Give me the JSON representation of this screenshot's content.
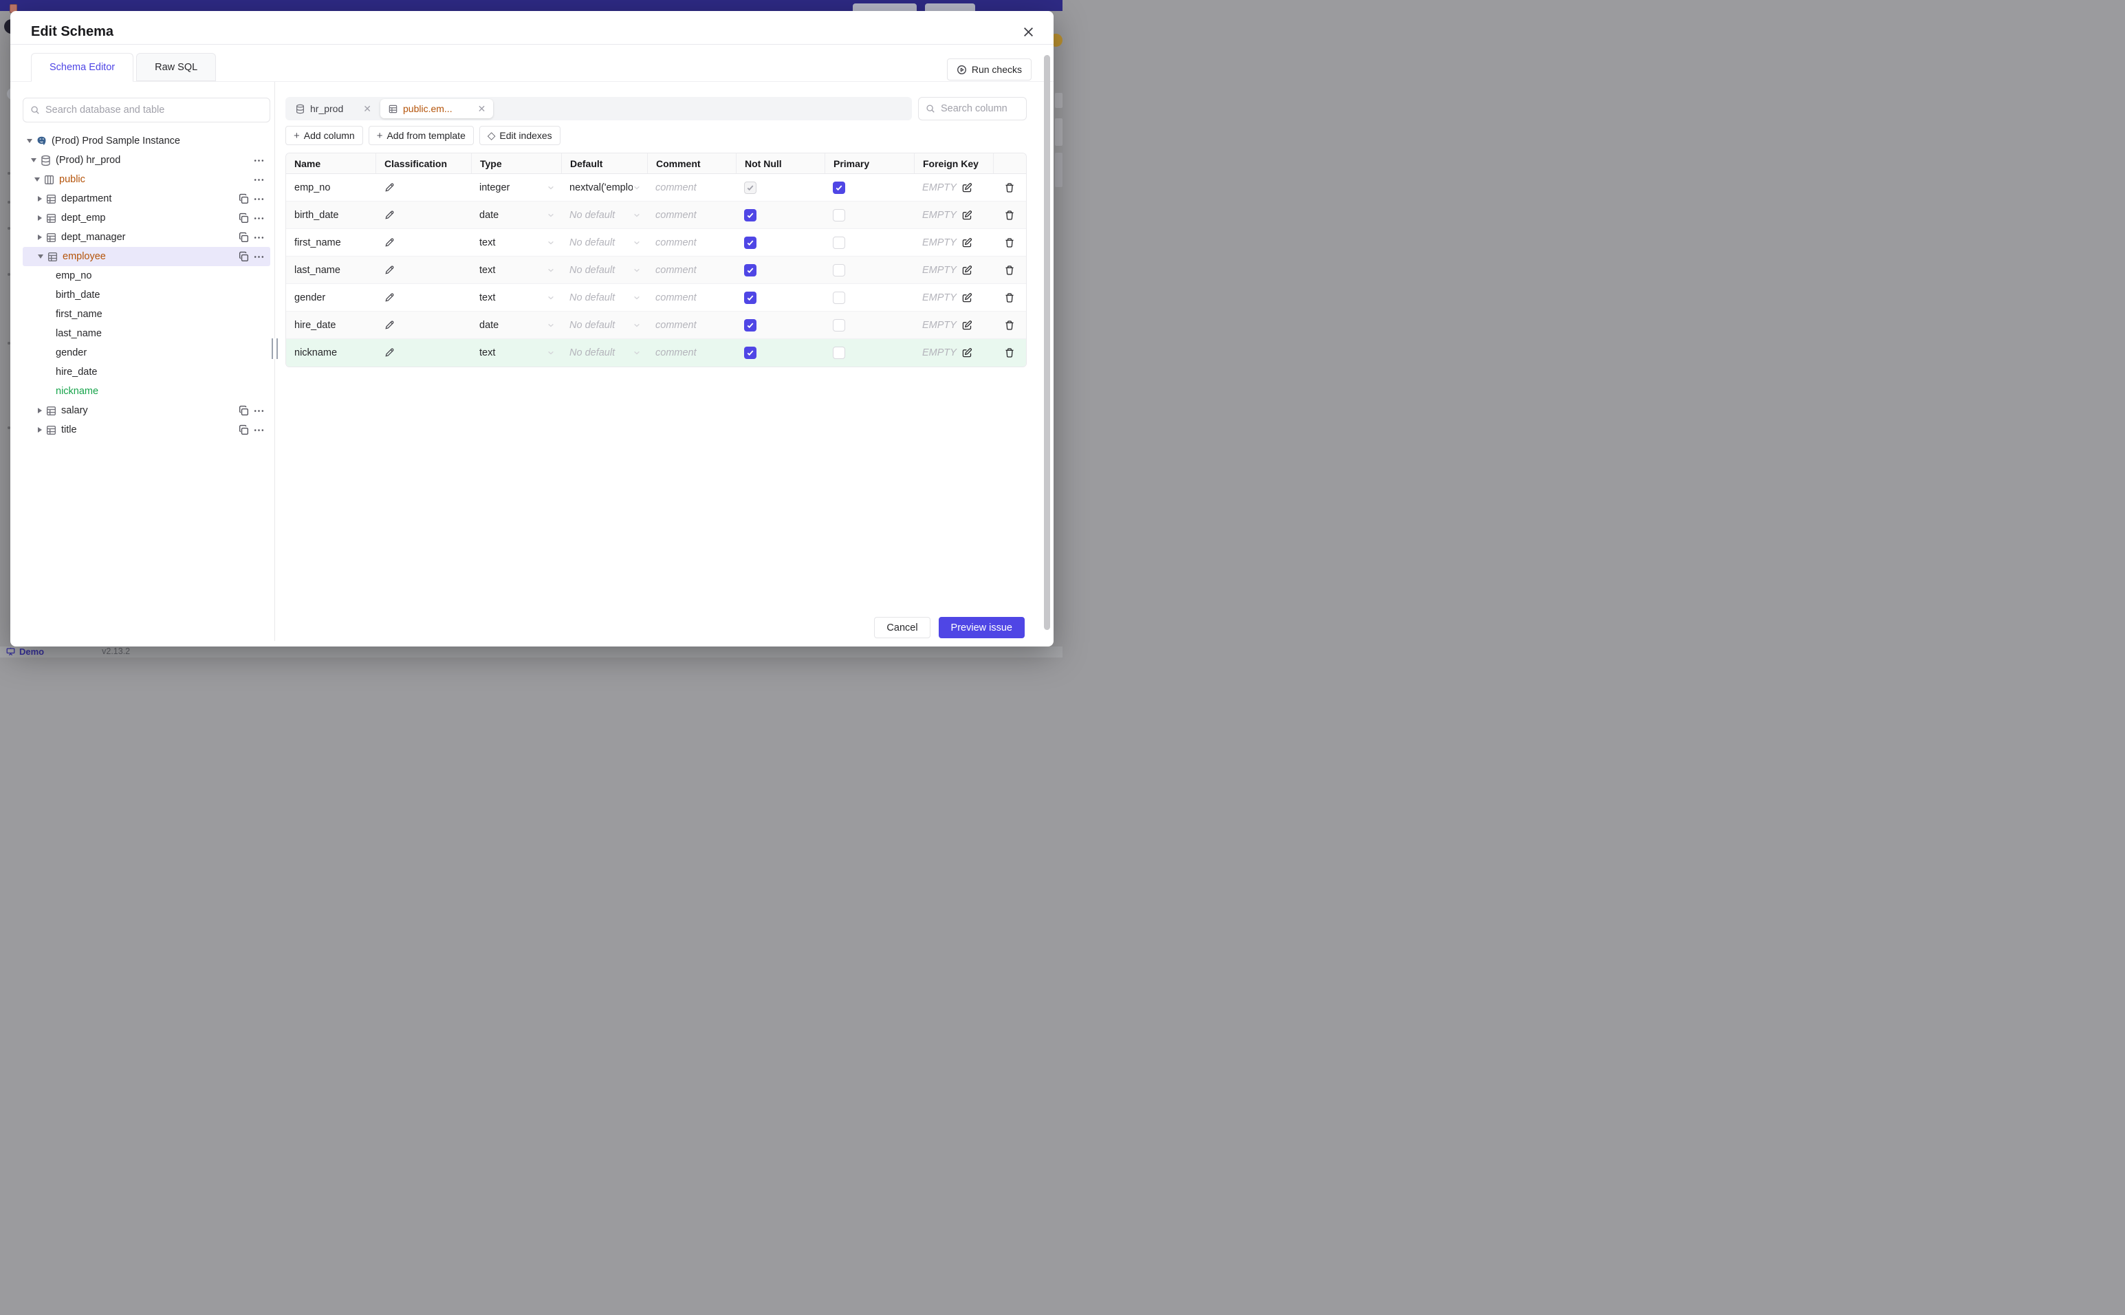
{
  "colors": {
    "accent": "#4f46e5",
    "banner": "#2e2a85",
    "modified_text": "#b45309",
    "created_text": "#16a34a",
    "created_row_bg": "#e9f8ef",
    "selected_tree_bg": "#eae8fa"
  },
  "backdrop": {
    "footer": {
      "demo_label": "Demo",
      "version": "v2.13.2"
    }
  },
  "modal": {
    "title": "Edit Schema",
    "tabs": [
      {
        "label": "Schema Editor",
        "active": true
      },
      {
        "label": "Raw SQL",
        "active": false
      }
    ],
    "run_checks": {
      "label": "Run checks",
      "icon": "play-circle-icon"
    },
    "sidebar": {
      "search_placeholder": "Search database and table",
      "tree": [
        {
          "label": "(Prod) Prod Sample Instance",
          "level": 0,
          "caret": "down",
          "icon": "postgres"
        },
        {
          "label": "(Prod) hr_prod",
          "level": 1,
          "caret": "down",
          "icon": "database",
          "menu": true
        },
        {
          "label": "public",
          "level": 2,
          "caret": "down",
          "icon": "schema",
          "color": "modified",
          "menu": true
        },
        {
          "label": "department",
          "level": 3,
          "caret": "right",
          "icon": "table",
          "copy": true,
          "menu": true
        },
        {
          "label": "dept_emp",
          "level": 3,
          "caret": "right",
          "icon": "table",
          "copy": true,
          "menu": true
        },
        {
          "label": "dept_manager",
          "level": 3,
          "caret": "right",
          "icon": "table",
          "copy": true,
          "menu": true
        },
        {
          "label": "employee",
          "level": 3,
          "caret": "down",
          "icon": "table",
          "color": "modified",
          "selected": true,
          "copy": true,
          "menu": true
        },
        {
          "label": "emp_no",
          "level": 4
        },
        {
          "label": "birth_date",
          "level": 4
        },
        {
          "label": "first_name",
          "level": 4
        },
        {
          "label": "last_name",
          "level": 4
        },
        {
          "label": "gender",
          "level": 4
        },
        {
          "label": "hire_date",
          "level": 4
        },
        {
          "label": "nickname",
          "level": 4,
          "color": "created"
        },
        {
          "label": "salary",
          "level": 3,
          "caret": "right",
          "icon": "table",
          "copy": true,
          "menu": true
        },
        {
          "label": "title",
          "level": 3,
          "caret": "right",
          "icon": "table",
          "copy": true,
          "menu": true
        }
      ]
    },
    "editor": {
      "chips": [
        {
          "label": "hr_prod",
          "icon": "database",
          "active": false
        },
        {
          "label": "public.em...",
          "icon": "table",
          "active": true
        }
      ],
      "search_placeholder": "Search column",
      "toolbar": [
        {
          "label": "Add column",
          "icon": "plus"
        },
        {
          "label": "Add from template",
          "icon": "plus"
        },
        {
          "label": "Edit indexes",
          "icon": "diamond"
        }
      ],
      "table": {
        "columns": [
          "Name",
          "Classification",
          "Type",
          "Default",
          "Comment",
          "Not Null",
          "Primary",
          "Foreign Key",
          ""
        ],
        "row_icons": {
          "classification": "pencil-icon",
          "dropdown": "chevron-down-icon",
          "foreign_key_edit": "edit-square-icon",
          "delete": "trash-icon"
        },
        "rows": [
          {
            "name": "emp_no",
            "type": "integer",
            "default": "nextval('employ",
            "default_is_placeholder": false,
            "comment_placeholder": "comment",
            "not_null": "checked-disabled",
            "primary": "checked",
            "foreign_key": "EMPTY",
            "state": "normal"
          },
          {
            "name": "birth_date",
            "type": "date",
            "default": "No default",
            "default_is_placeholder": true,
            "comment_placeholder": "comment",
            "not_null": "checked",
            "primary": "unchecked",
            "foreign_key": "EMPTY",
            "state": "normal"
          },
          {
            "name": "first_name",
            "type": "text",
            "default": "No default",
            "default_is_placeholder": true,
            "comment_placeholder": "comment",
            "not_null": "checked",
            "primary": "unchecked",
            "foreign_key": "EMPTY",
            "state": "normal"
          },
          {
            "name": "last_name",
            "type": "text",
            "default": "No default",
            "default_is_placeholder": true,
            "comment_placeholder": "comment",
            "not_null": "checked",
            "primary": "unchecked",
            "foreign_key": "EMPTY",
            "state": "normal"
          },
          {
            "name": "gender",
            "type": "text",
            "default": "No default",
            "default_is_placeholder": true,
            "comment_placeholder": "comment",
            "not_null": "checked",
            "primary": "unchecked",
            "foreign_key": "EMPTY",
            "state": "normal"
          },
          {
            "name": "hire_date",
            "type": "date",
            "default": "No default",
            "default_is_placeholder": true,
            "comment_placeholder": "comment",
            "not_null": "checked",
            "primary": "unchecked",
            "foreign_key": "EMPTY",
            "state": "normal"
          },
          {
            "name": "nickname",
            "type": "text",
            "default": "No default",
            "default_is_placeholder": true,
            "comment_placeholder": "comment",
            "not_null": "checked",
            "primary": "unchecked",
            "foreign_key": "EMPTY",
            "state": "created"
          }
        ]
      }
    },
    "footer": {
      "cancel_label": "Cancel",
      "preview_label": "Preview issue"
    }
  }
}
